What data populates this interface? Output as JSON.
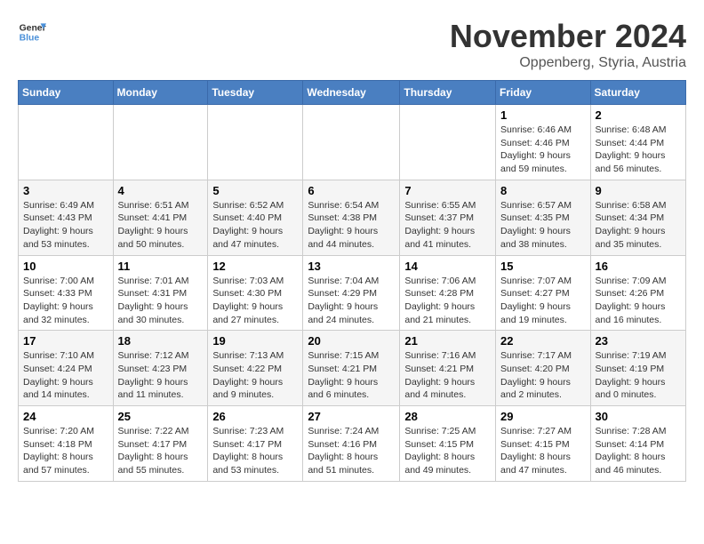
{
  "logo": {
    "line1": "General",
    "line2": "Blue"
  },
  "title": "November 2024",
  "subtitle": "Oppenberg, Styria, Austria",
  "weekdays": [
    "Sunday",
    "Monday",
    "Tuesday",
    "Wednesday",
    "Thursday",
    "Friday",
    "Saturday"
  ],
  "weeks": [
    [
      {
        "day": "",
        "info": ""
      },
      {
        "day": "",
        "info": ""
      },
      {
        "day": "",
        "info": ""
      },
      {
        "day": "",
        "info": ""
      },
      {
        "day": "",
        "info": ""
      },
      {
        "day": "1",
        "info": "Sunrise: 6:46 AM\nSunset: 4:46 PM\nDaylight: 9 hours and 59 minutes."
      },
      {
        "day": "2",
        "info": "Sunrise: 6:48 AM\nSunset: 4:44 PM\nDaylight: 9 hours and 56 minutes."
      }
    ],
    [
      {
        "day": "3",
        "info": "Sunrise: 6:49 AM\nSunset: 4:43 PM\nDaylight: 9 hours and 53 minutes."
      },
      {
        "day": "4",
        "info": "Sunrise: 6:51 AM\nSunset: 4:41 PM\nDaylight: 9 hours and 50 minutes."
      },
      {
        "day": "5",
        "info": "Sunrise: 6:52 AM\nSunset: 4:40 PM\nDaylight: 9 hours and 47 minutes."
      },
      {
        "day": "6",
        "info": "Sunrise: 6:54 AM\nSunset: 4:38 PM\nDaylight: 9 hours and 44 minutes."
      },
      {
        "day": "7",
        "info": "Sunrise: 6:55 AM\nSunset: 4:37 PM\nDaylight: 9 hours and 41 minutes."
      },
      {
        "day": "8",
        "info": "Sunrise: 6:57 AM\nSunset: 4:35 PM\nDaylight: 9 hours and 38 minutes."
      },
      {
        "day": "9",
        "info": "Sunrise: 6:58 AM\nSunset: 4:34 PM\nDaylight: 9 hours and 35 minutes."
      }
    ],
    [
      {
        "day": "10",
        "info": "Sunrise: 7:00 AM\nSunset: 4:33 PM\nDaylight: 9 hours and 32 minutes."
      },
      {
        "day": "11",
        "info": "Sunrise: 7:01 AM\nSunset: 4:31 PM\nDaylight: 9 hours and 30 minutes."
      },
      {
        "day": "12",
        "info": "Sunrise: 7:03 AM\nSunset: 4:30 PM\nDaylight: 9 hours and 27 minutes."
      },
      {
        "day": "13",
        "info": "Sunrise: 7:04 AM\nSunset: 4:29 PM\nDaylight: 9 hours and 24 minutes."
      },
      {
        "day": "14",
        "info": "Sunrise: 7:06 AM\nSunset: 4:28 PM\nDaylight: 9 hours and 21 minutes."
      },
      {
        "day": "15",
        "info": "Sunrise: 7:07 AM\nSunset: 4:27 PM\nDaylight: 9 hours and 19 minutes."
      },
      {
        "day": "16",
        "info": "Sunrise: 7:09 AM\nSunset: 4:26 PM\nDaylight: 9 hours and 16 minutes."
      }
    ],
    [
      {
        "day": "17",
        "info": "Sunrise: 7:10 AM\nSunset: 4:24 PM\nDaylight: 9 hours and 14 minutes."
      },
      {
        "day": "18",
        "info": "Sunrise: 7:12 AM\nSunset: 4:23 PM\nDaylight: 9 hours and 11 minutes."
      },
      {
        "day": "19",
        "info": "Sunrise: 7:13 AM\nSunset: 4:22 PM\nDaylight: 9 hours and 9 minutes."
      },
      {
        "day": "20",
        "info": "Sunrise: 7:15 AM\nSunset: 4:21 PM\nDaylight: 9 hours and 6 minutes."
      },
      {
        "day": "21",
        "info": "Sunrise: 7:16 AM\nSunset: 4:21 PM\nDaylight: 9 hours and 4 minutes."
      },
      {
        "day": "22",
        "info": "Sunrise: 7:17 AM\nSunset: 4:20 PM\nDaylight: 9 hours and 2 minutes."
      },
      {
        "day": "23",
        "info": "Sunrise: 7:19 AM\nSunset: 4:19 PM\nDaylight: 9 hours and 0 minutes."
      }
    ],
    [
      {
        "day": "24",
        "info": "Sunrise: 7:20 AM\nSunset: 4:18 PM\nDaylight: 8 hours and 57 minutes."
      },
      {
        "day": "25",
        "info": "Sunrise: 7:22 AM\nSunset: 4:17 PM\nDaylight: 8 hours and 55 minutes."
      },
      {
        "day": "26",
        "info": "Sunrise: 7:23 AM\nSunset: 4:17 PM\nDaylight: 8 hours and 53 minutes."
      },
      {
        "day": "27",
        "info": "Sunrise: 7:24 AM\nSunset: 4:16 PM\nDaylight: 8 hours and 51 minutes."
      },
      {
        "day": "28",
        "info": "Sunrise: 7:25 AM\nSunset: 4:15 PM\nDaylight: 8 hours and 49 minutes."
      },
      {
        "day": "29",
        "info": "Sunrise: 7:27 AM\nSunset: 4:15 PM\nDaylight: 8 hours and 47 minutes."
      },
      {
        "day": "30",
        "info": "Sunrise: 7:28 AM\nSunset: 4:14 PM\nDaylight: 8 hours and 46 minutes."
      }
    ]
  ]
}
